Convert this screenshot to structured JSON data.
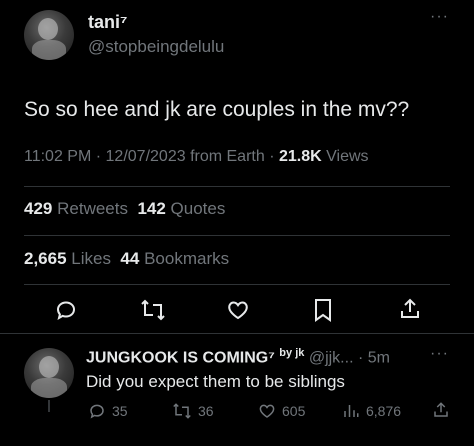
{
  "tweet": {
    "display_name": "tani⁷",
    "handle": "@stopbeingdelulu",
    "text": "So so hee and jk are couples in the mv??",
    "time": "11:02 PM",
    "date": "12/07/2023",
    "location": "from Earth",
    "views_count": "21.8K",
    "views_label": "Views",
    "retweets_count": "429",
    "retweets_label": "Retweets",
    "quotes_count": "142",
    "quotes_label": "Quotes",
    "likes_count": "2,665",
    "likes_label": "Likes",
    "bookmarks_count": "44",
    "bookmarks_label": "Bookmarks",
    "more_label": "···"
  },
  "reply": {
    "display_name": "JUNGKOOK IS COMING⁷",
    "name_suffix": "by jk",
    "handle": "@jjk...",
    "separator": "·",
    "time": "5m",
    "more_label": "···",
    "text": "Did you expect them to be siblings",
    "reply_count": "35",
    "retweet_count": "36",
    "like_count": "605",
    "view_count": "6,876"
  },
  "colors": {
    "background": "#000000",
    "text": "#e7e9ea",
    "muted": "#71767b",
    "divider": "#2f3336"
  },
  "icons": [
    "reply-icon",
    "retweet-icon",
    "like-icon",
    "bookmark-icon",
    "share-icon",
    "views-icon",
    "more-icon"
  ]
}
